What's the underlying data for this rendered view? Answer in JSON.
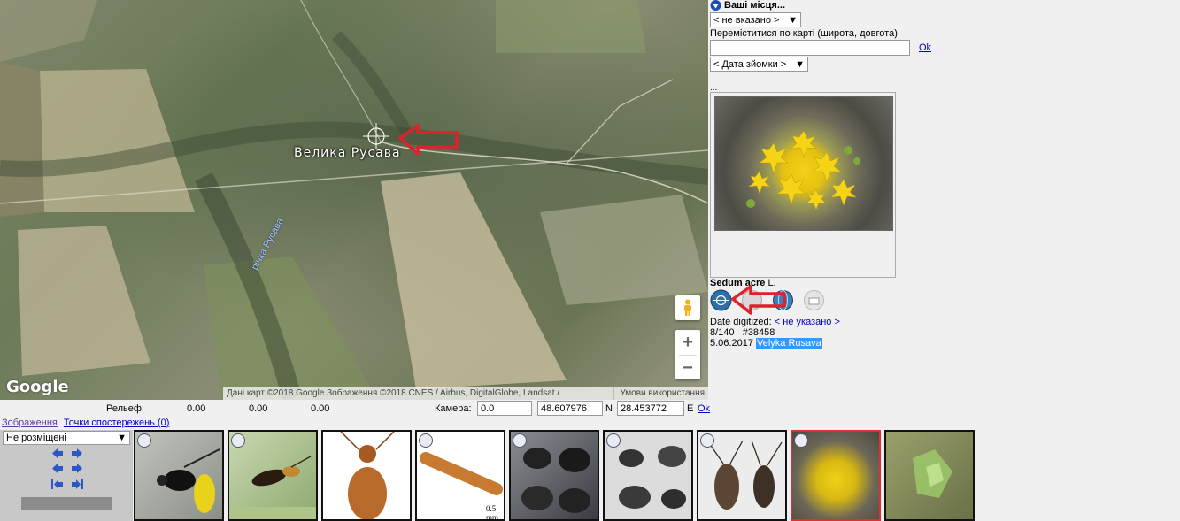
{
  "map": {
    "town_label": "Велика Русава",
    "river_label": "річка Русава",
    "logo": "Google",
    "attribution": "Дані карт ©2018 Google Зображення ©2018 CNES / Airbus, DigitalGlobe, Landsat / Copernicus",
    "terms": "Умови використання",
    "zoom_in": "+",
    "zoom_out": "−",
    "icons": [
      "crosshair-icon",
      "pegman-icon",
      "red-arrow-icon"
    ]
  },
  "right_panel": {
    "places_title": "Ваші місця...",
    "places_select": "< не вказано >",
    "move_label": "Переміститися по карті (широта, довгота)",
    "coord_value": "",
    "ok_label": "Ok",
    "date_select": "< Дата зйомки >",
    "ellipsis": "...",
    "species_name": "Sedum acre",
    "species_author": "L.",
    "date_digitized_label": "Date digitized:",
    "date_digitized_value": "< не указано >",
    "counts": "8/140   #38458",
    "photo_date": "5.06.2017",
    "location": "Velyka Rusava"
  },
  "status_row": {
    "relief_label": "Рельеф:",
    "relief_values": [
      "0.00",
      "0.00",
      "0.00"
    ],
    "camera_label": "Камера:",
    "camera_value": "0.0",
    "lat_value": "48.607976",
    "lat_unit": "N",
    "lon_value": "28.453772",
    "lon_unit": "E",
    "ok_label": "Ok"
  },
  "tabs": {
    "images": "Зображення",
    "points": "Точки спостережень (0)"
  },
  "controls": {
    "placement_select": "Не розміщені"
  },
  "thumbnails": [
    {
      "label": "wasp-thumbnail"
    },
    {
      "label": "wasp-2-thumbnail"
    },
    {
      "label": "beetle-orange-thumbnail"
    },
    {
      "label": "antenna-thumbnail",
      "scale_text": "0.5 mm"
    },
    {
      "label": "dark-beetle-grid-thumbnail"
    },
    {
      "label": "beetle-grid-2-thumbnail"
    },
    {
      "label": "longhorn-beetle-thumbnail"
    },
    {
      "label": "sedum-acre-thumbnail",
      "active": true
    },
    {
      "label": "green-plant-thumbnail"
    }
  ],
  "colors": {
    "link": "#0000cc",
    "highlight": "#3399ff",
    "active_border": "#e03030",
    "arrow": "#e0202a"
  }
}
